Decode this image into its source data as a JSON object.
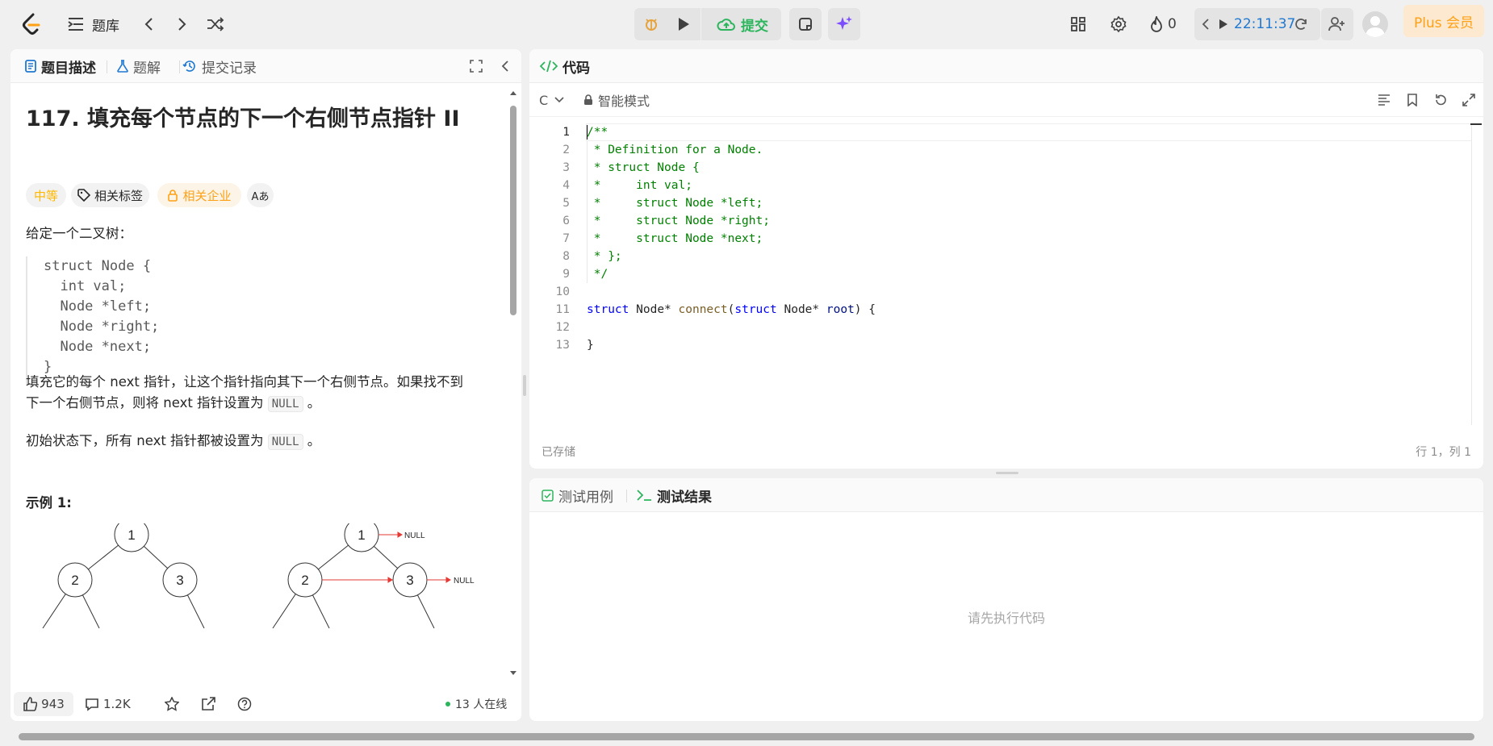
{
  "topbar": {
    "problem_list": "题库",
    "submit": "提交",
    "streak": "0",
    "timer": "22:11:37",
    "plus": "Plus 会员"
  },
  "left": {
    "tabs": [
      "题目描述",
      "题解",
      "提交记录"
    ],
    "title": "117. 填充每个节点的下一个右侧节点指针 II",
    "tags": [
      "中等",
      "相关标签",
      "相关企业",
      "Aあ"
    ],
    "intro": "给定一个二叉树：",
    "struct_lines": [
      "struct Node {",
      "  int val;",
      "  Node *left;",
      "  Node *right;",
      "  Node *next;",
      "}"
    ],
    "para1a": "填充它的每个 next 指针，让这个指针指向其下一个右侧节点。如果找不到",
    "para1b": "下一个右侧节点，则将 next 指针设置为",
    "null": "NULL",
    "period": "。",
    "para2": "初始状态下，所有 next 指针都被设置为",
    "example": "示例 1:",
    "tree_nodes": [
      "1",
      "2",
      "3"
    ],
    "null_label": "NULL",
    "likes": "943",
    "comments": "1.2K",
    "online": "13 人在线"
  },
  "editor": {
    "tab": "代码",
    "lang": "C",
    "mode": "智能模式",
    "saved": "已存储",
    "cursor": "行 1，列 1",
    "line_numbers": [
      "1",
      "2",
      "3",
      "4",
      "5",
      "6",
      "7",
      "8",
      "9",
      "10",
      "11",
      "12",
      "13"
    ],
    "comment_lines": [
      "/**",
      " * Definition for a Node.",
      " * struct Node {",
      " *     int val;",
      " *     struct Node *left;",
      " *     struct Node *right;",
      " *     struct Node *next;",
      " * };",
      " */"
    ],
    "code_line11": {
      "kw1": "struct",
      "type1": "Node*",
      "fn": "connect",
      "kw2": "struct",
      "type2": "Node*",
      "param": "root"
    },
    "close_brace": "}"
  },
  "console": {
    "tabs": [
      "测试用例",
      "测试结果"
    ],
    "empty": "请先执行代码"
  },
  "colors": {
    "accent_green": "#2db55d",
    "blue": "#007aff",
    "orange": "#ffa116"
  }
}
